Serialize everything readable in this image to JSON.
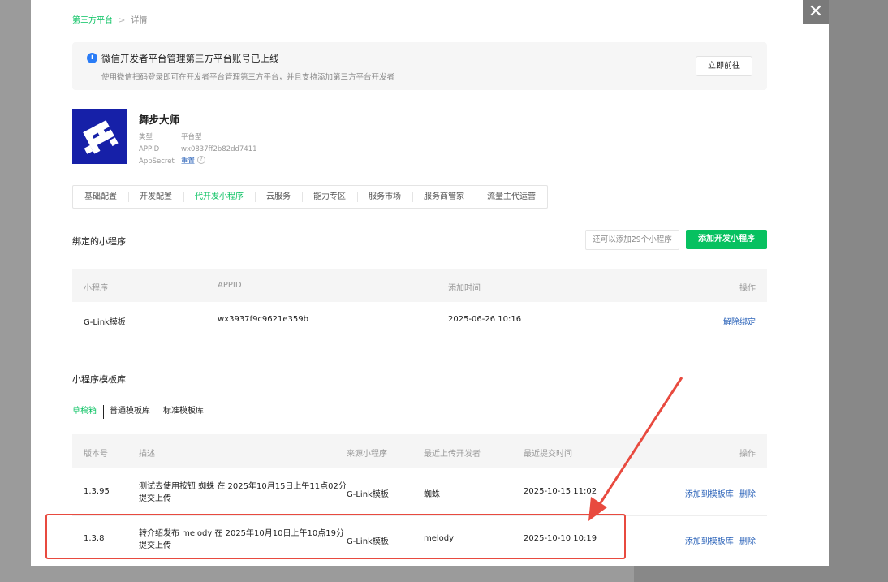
{
  "breadcrumb": {
    "root": "第三方平台",
    "separator": ">",
    "current": "详情"
  },
  "notice": {
    "title": "微信开发者平台管理第三方平台账号已上线",
    "desc": "使用微信扫码登录即可在开发者平台管理第三方平台，并且支持添加第三方平台开发者",
    "button": "立即前往"
  },
  "app": {
    "name": "舞步大师",
    "fields": [
      {
        "label": "类型",
        "value": "平台型"
      },
      {
        "label": "APPID",
        "value": "wx0837ff2b82dd7411"
      }
    ],
    "secret_label": "AppSecret",
    "secret_action": "重置",
    "help_glyph": "?"
  },
  "tabs": [
    {
      "label": "基础配置",
      "active": false
    },
    {
      "label": "开发配置",
      "active": false
    },
    {
      "label": "代开发小程序",
      "active": true
    },
    {
      "label": "云服务",
      "active": false
    },
    {
      "label": "能力专区",
      "active": false
    },
    {
      "label": "服务市场",
      "active": false
    },
    {
      "label": "服务商管家",
      "active": false
    },
    {
      "label": "流量主代运营",
      "active": false
    }
  ],
  "bound": {
    "title": "绑定的小程序",
    "hint": "还可以添加29个小程序",
    "add_button": "添加开发小程序",
    "headers": {
      "name": "小程序",
      "appid": "APPID",
      "time": "添加时间",
      "action": "操作"
    },
    "rows": [
      {
        "name": "G-Link模板",
        "appid": "wx3937f9c9621e359b",
        "time": "2025-06-26 10:16",
        "action": "解除绑定"
      }
    ]
  },
  "templates": {
    "title": "小程序模板库",
    "subtabs": [
      "草稿箱",
      "普通模板库",
      "标准模板库"
    ],
    "headers": {
      "version": "版本号",
      "desc": "描述",
      "source": "来源小程序",
      "uploader": "最近上传开发者",
      "time": "最近提交时间",
      "action": "操作"
    },
    "rows": [
      {
        "version": "1.3.95",
        "desc_line1": "测试去使用按钮 蜘蛛 在 2025年10月15日上午11点02分",
        "desc_line2": "提交上传",
        "source": "G-Link模板",
        "uploader": "蜘蛛",
        "time": "2025-10-15 11:02",
        "action_add": "添加到模板库",
        "action_delete": "删除"
      },
      {
        "version": "1.3.8",
        "desc_line1": "转介绍发布 melody 在 2025年10月10日上午10点19分",
        "desc_line2": "提交上传",
        "source": "G-Link模板",
        "uploader": "melody",
        "time": "2025-10-10 10:19",
        "action_add": "添加到模板库",
        "action_delete": "删除"
      }
    ]
  },
  "close_glyph": "✕",
  "colors": {
    "accent": "#07c160",
    "link": "#2b63b9",
    "annotation": "#e84a3f"
  }
}
